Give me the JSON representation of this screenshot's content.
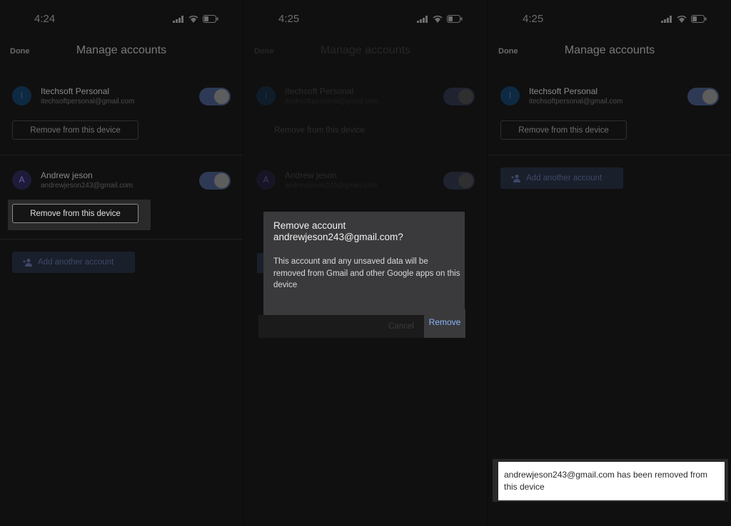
{
  "panels": [
    {
      "time": "4:24",
      "done": "Done",
      "title": "Manage accounts",
      "accounts": [
        {
          "initial": "I",
          "name": "Itechsoft Personal",
          "email": "itechsoftpersonal@gmail.com",
          "remove_label": "Remove from this device"
        },
        {
          "initial": "A",
          "name": "Andrew jeson",
          "email": "andrewjeson243@gmail.com",
          "remove_label": "Remove from this device"
        }
      ],
      "add_label": "Add another account"
    },
    {
      "time": "4:25",
      "done": "Done",
      "title": "Manage accounts",
      "accounts": [
        {
          "initial": "I",
          "name": "Itechsoft Personal",
          "email": "itechsoftpersonal@gmail.com",
          "remove_label": "Remove from this device"
        },
        {
          "initial": "A",
          "name": "Andrew jeson",
          "email": "andrewjeson243@gmail.com"
        }
      ],
      "dialog": {
        "title_line1": "Remove account",
        "title_line2": "andrewjeson243@gmail.com?",
        "body": "This account and any unsaved data will be removed from Gmail and other Google apps on this device",
        "cancel": "Cancel",
        "remove": "Remove"
      }
    },
    {
      "time": "4:25",
      "done": "Done",
      "title": "Manage accounts",
      "accounts": [
        {
          "initial": "I",
          "name": "Itechsoft Personal",
          "email": "itechsoftpersonal@gmail.com",
          "remove_label": "Remove from this device"
        }
      ],
      "add_label": "Add another account",
      "toast": "andrewjeson243@gmail.com has been removed from this device"
    }
  ],
  "colors": {
    "accent": "#8ab4f8",
    "toggle_track": "#2e3a55",
    "dialog_bg": "#3a3a3c"
  },
  "icons": [
    "signal-icon",
    "wifi-icon",
    "battery-icon",
    "add-person-icon"
  ]
}
